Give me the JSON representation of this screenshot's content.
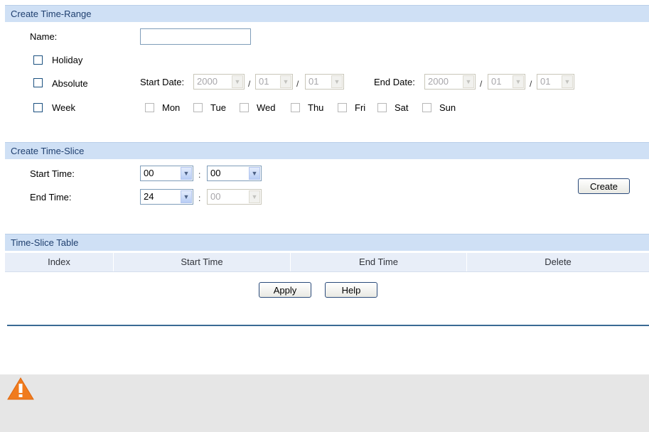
{
  "time_range": {
    "header": "Create Time-Range",
    "name_label": "Name:",
    "name_value": "",
    "holiday_label": "Holiday",
    "absolute_label": "Absolute",
    "week_label": "Week",
    "start_date_label": "Start Date:",
    "end_date_label": "End Date:",
    "date_sep": "/",
    "start_date": {
      "year": "2000",
      "month": "01",
      "day": "01"
    },
    "end_date": {
      "year": "2000",
      "month": "01",
      "day": "01"
    },
    "days": [
      "Mon",
      "Tue",
      "Wed",
      "Thu",
      "Fri",
      "Sat",
      "Sun"
    ]
  },
  "time_slice": {
    "header": "Create Time-Slice",
    "start_label": "Start Time:",
    "end_label": "End Time:",
    "start_hour": "00",
    "start_min": "00",
    "end_hour": "24",
    "end_min": "00",
    "sep": ":",
    "create_label": "Create"
  },
  "table": {
    "header": "Time-Slice Table",
    "columns": [
      "Index",
      "Start Time",
      "End Time",
      "Delete"
    ]
  },
  "buttons": {
    "apply": "Apply",
    "help": "Help"
  },
  "colors": {
    "header_bg": "#cfe0f5",
    "header_text": "#1f3f6f",
    "warning": "#f07b1d",
    "note_bg": "#e6e6e6"
  },
  "icons": {
    "warning": "warning-icon"
  }
}
